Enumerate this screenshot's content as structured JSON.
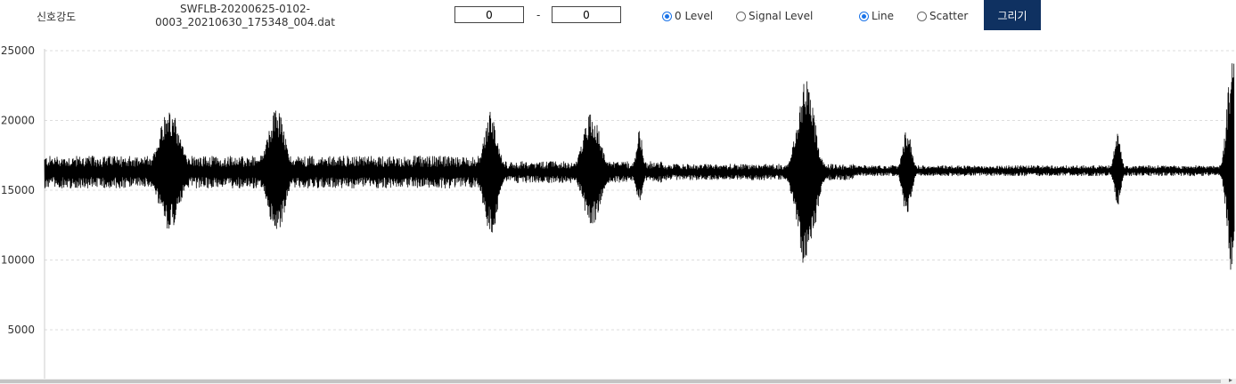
{
  "toolbar": {
    "title": "신호강도",
    "filename_line1": "SWFLB-20200625-0102-",
    "filename_line2": "0003_20210630_175348_004.dat",
    "range_from": "0",
    "range_separator": "-",
    "range_to": "0",
    "level_options": [
      {
        "label": "0 Level",
        "checked": true
      },
      {
        "label": "Signal Level",
        "checked": false
      }
    ],
    "style_options": [
      {
        "label": "Line",
        "checked": true
      },
      {
        "label": "Scatter",
        "checked": false
      }
    ],
    "draw_label": "그리기",
    "draw_color": "#0f3161",
    "radio_accent": "#1a73e8"
  },
  "chart_data": {
    "type": "line",
    "title": "",
    "xlabel": "",
    "ylabel": "",
    "ylim": [
      2800,
      25000
    ],
    "yticks": [
      5000,
      10000,
      15000,
      20000,
      25000
    ],
    "grid": "horizontal-dashed",
    "line_color": "#000000",
    "baseline_segments": [
      {
        "x_start": 0,
        "x_end": 0.37,
        "center": 16300,
        "halfwidth": 900
      },
      {
        "x_start": 0.37,
        "x_end": 0.52,
        "center": 16300,
        "halfwidth": 600
      },
      {
        "x_start": 0.52,
        "x_end": 0.68,
        "center": 16300,
        "halfwidth": 450
      },
      {
        "x_start": 0.68,
        "x_end": 1.0,
        "center": 16400,
        "halfwidth": 300
      }
    ],
    "bursts": [
      {
        "x": 0.105,
        "max": 20900,
        "min": 12100,
        "width": 0.012
      },
      {
        "x": 0.195,
        "max": 20900,
        "min": 11800,
        "width": 0.01
      },
      {
        "x": 0.375,
        "max": 20700,
        "min": 11700,
        "width": 0.008
      },
      {
        "x": 0.46,
        "max": 20600,
        "min": 12400,
        "width": 0.01
      },
      {
        "x": 0.5,
        "max": 19300,
        "min": 14100,
        "width": 0.004
      },
      {
        "x": 0.64,
        "max": 22900,
        "min": 8800,
        "width": 0.01
      },
      {
        "x": 0.725,
        "max": 19400,
        "min": 12800,
        "width": 0.005
      },
      {
        "x": 0.902,
        "max": 19100,
        "min": 13800,
        "width": 0.004
      },
      {
        "x": 0.9985,
        "max": 24900,
        "min": 8600,
        "width": 0.006
      }
    ]
  }
}
